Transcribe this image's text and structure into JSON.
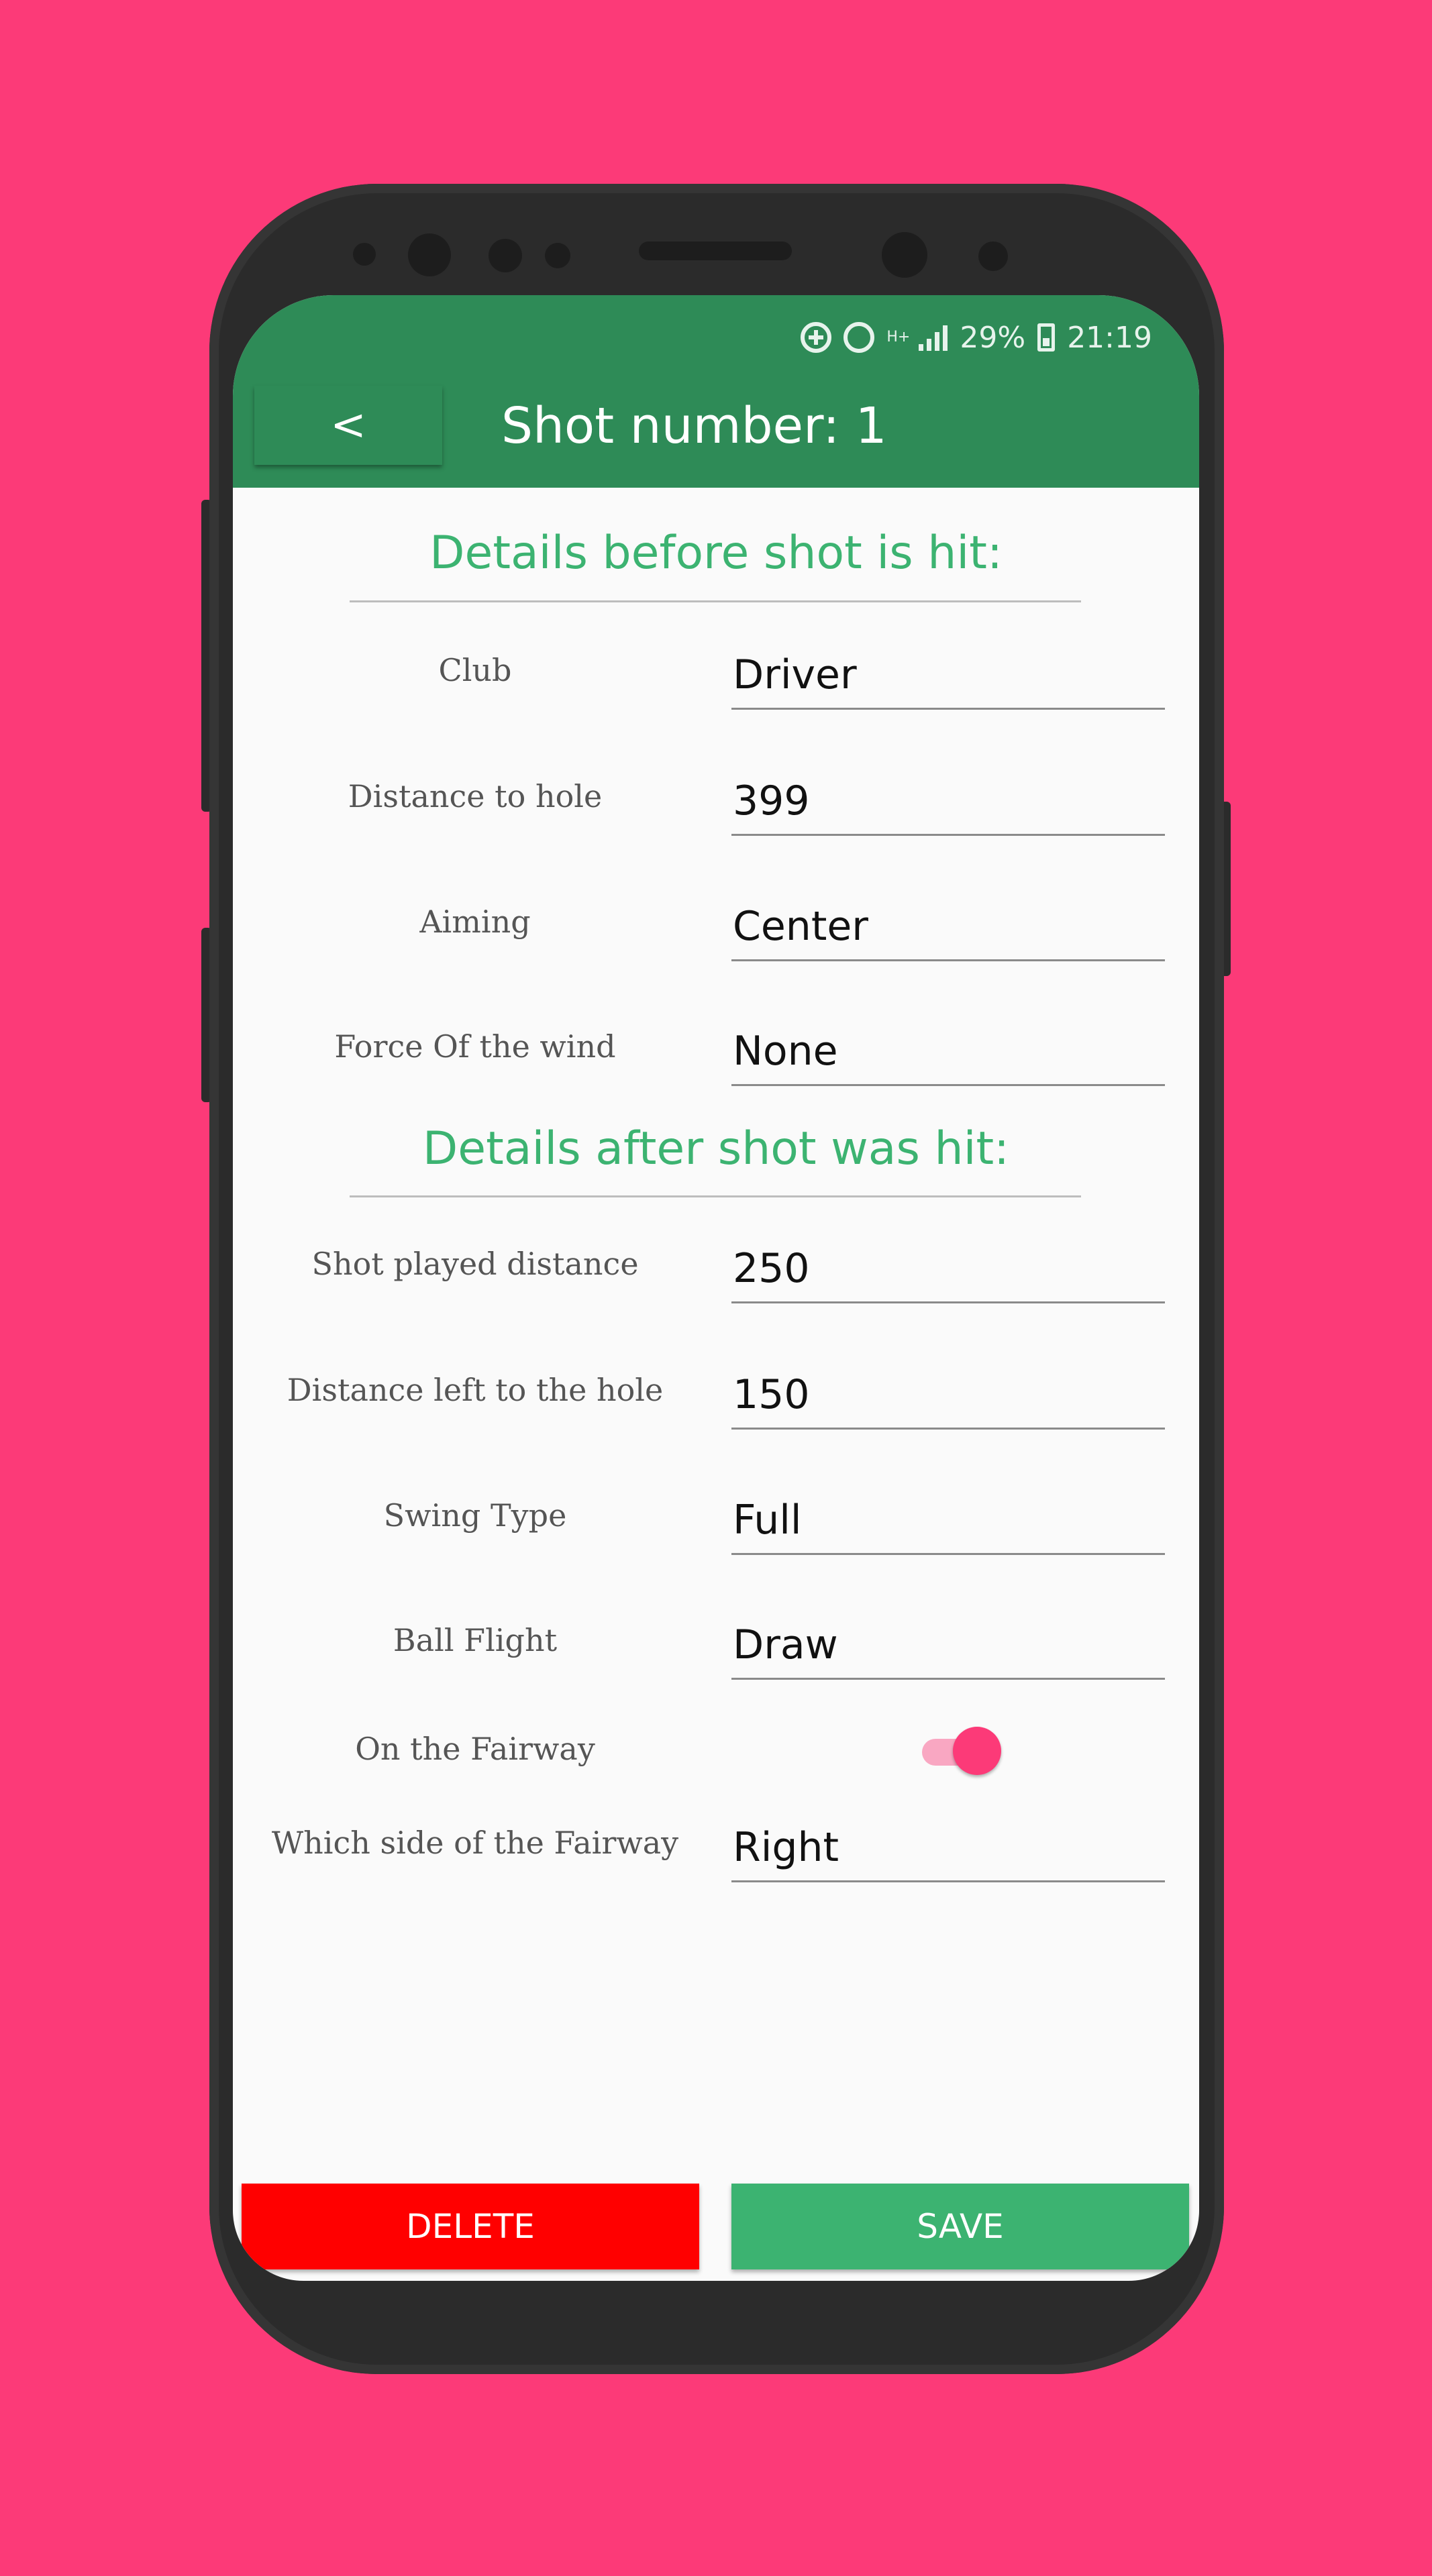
{
  "status_bar": {
    "battery": "29%",
    "time": "21:19",
    "network": "H+",
    "icons": [
      "data-saver-icon",
      "alarm-icon",
      "network-hplus-icon",
      "signal-icon",
      "battery-icon"
    ]
  },
  "app_bar": {
    "back_label": "<",
    "title": "Shot number: 1"
  },
  "sections": {
    "before_title": "Details before shot is hit:",
    "after_title": "Details after shot was hit:"
  },
  "before_fields": [
    {
      "label": "Club",
      "value": "Driver"
    },
    {
      "label": "Distance to hole",
      "value": "399"
    },
    {
      "label": "Aiming",
      "value": "Center"
    },
    {
      "label": "Force Of the wind",
      "value": "None"
    }
  ],
  "after_fields": [
    {
      "label": "Shot played distance",
      "value": "250"
    },
    {
      "label": "Distance left to the hole",
      "value": "150"
    },
    {
      "label": "Swing Type",
      "value": "Full"
    },
    {
      "label": "Ball Flight",
      "value": "Draw"
    }
  ],
  "fairway": {
    "label": "On the Fairway",
    "on": true
  },
  "fairway_side": {
    "label": "Which side of the Fairway",
    "value": "Right"
  },
  "buttons": {
    "delete": "DELETE",
    "save": "SAVE"
  },
  "colors": {
    "background": "#fc3a78",
    "app_bar": "#2e8b57",
    "accent_green": "#3cb371",
    "delete_red": "#ff0000",
    "toggle_on": "#fc3a78"
  }
}
